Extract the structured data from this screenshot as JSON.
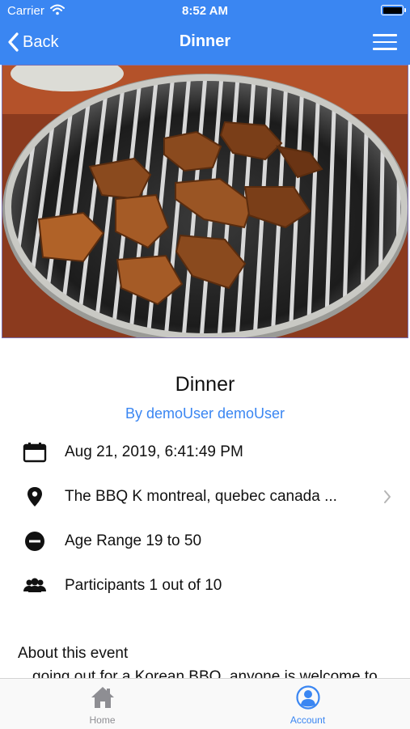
{
  "status_bar": {
    "carrier": "Carrier",
    "time": "8:52 AM"
  },
  "nav": {
    "back_label": "Back",
    "title": "Dinner"
  },
  "event": {
    "title": "Dinner",
    "by": "By demoUser demoUser",
    "date": "Aug 21, 2019, 6:41:49 PM",
    "location": "The BBQ K montreal, quebec canada ...",
    "age_range": "Age Range 19 to 50",
    "participants": "Participants 1 out of 10"
  },
  "about": {
    "heading": "About this event",
    "body": "going out for a Korean BBQ, anyone is welcome to"
  },
  "tabs": [
    {
      "label": "Home",
      "icon": "home-icon",
      "active": false
    },
    {
      "label": "Account",
      "icon": "account-icon",
      "active": true
    }
  ],
  "colors": {
    "accent": "#3a86f2",
    "tab_inactive": "#8e8e93"
  }
}
